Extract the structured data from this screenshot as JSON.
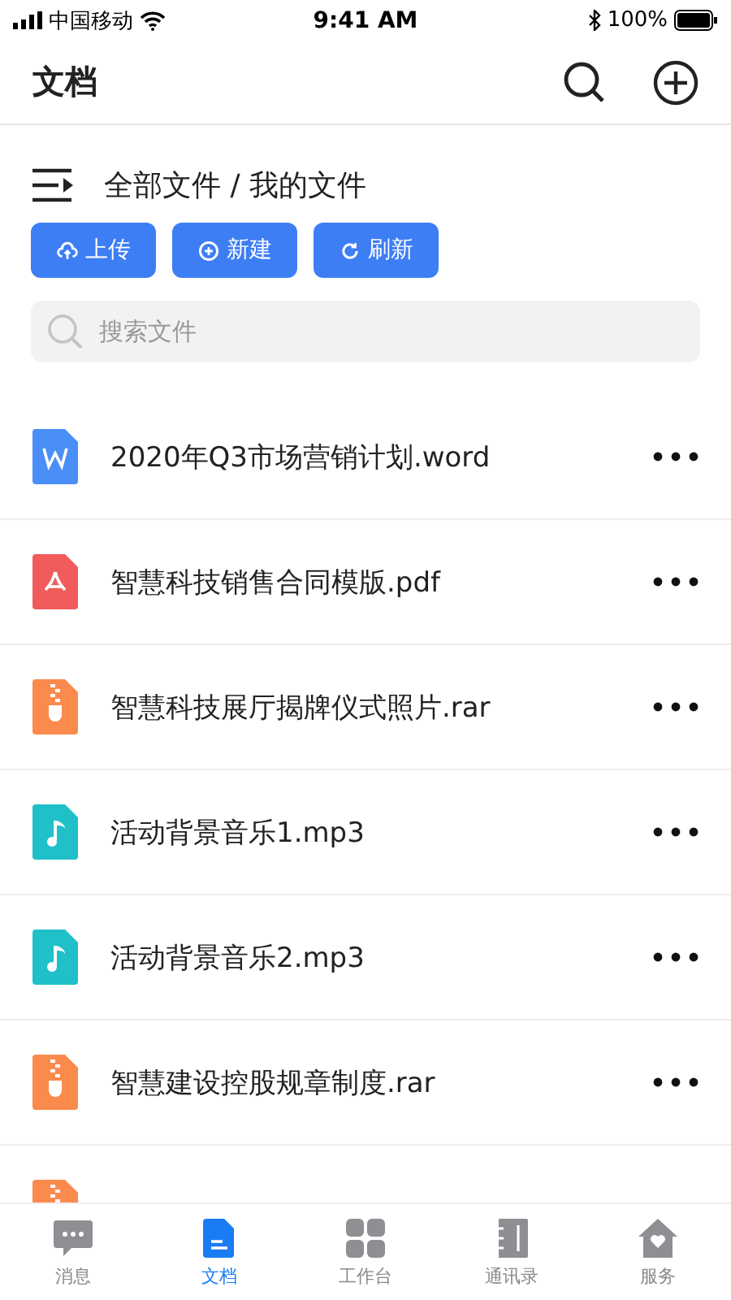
{
  "status_bar": {
    "carrier": "中国移动",
    "time": "9:41 AM",
    "battery": "100%"
  },
  "header": {
    "title": "文档"
  },
  "breadcrumb": "全部文件 / 我的文件",
  "actions": [
    {
      "kind": "upload",
      "label": "上传"
    },
    {
      "kind": "new",
      "label": "新建"
    },
    {
      "kind": "refresh",
      "label": "刷新"
    }
  ],
  "search": {
    "placeholder": "搜索文件"
  },
  "files": [
    {
      "kind": "word",
      "name": "2020年Q3市场营销计划.word"
    },
    {
      "kind": "pdf",
      "name": "智慧科技销售合同模版.pdf"
    },
    {
      "kind": "archive",
      "name": "智慧科技展厅揭牌仪式照片.rar"
    },
    {
      "kind": "audio",
      "name": "活动背景音乐1.mp3"
    },
    {
      "kind": "audio",
      "name": "活动背景音乐2.mp3"
    },
    {
      "kind": "archive",
      "name": "智慧建设控股规章制度.rar"
    },
    {
      "kind": "archive"
    }
  ],
  "tabs": [
    {
      "kind": "messages",
      "label": "消息",
      "selected": false
    },
    {
      "kind": "docs",
      "label": "文档",
      "selected": true
    },
    {
      "kind": "workbench",
      "label": "工作台",
      "selected": false
    },
    {
      "kind": "contacts",
      "label": "通讯录",
      "selected": false
    },
    {
      "kind": "services",
      "label": "服务",
      "selected": false
    }
  ]
}
